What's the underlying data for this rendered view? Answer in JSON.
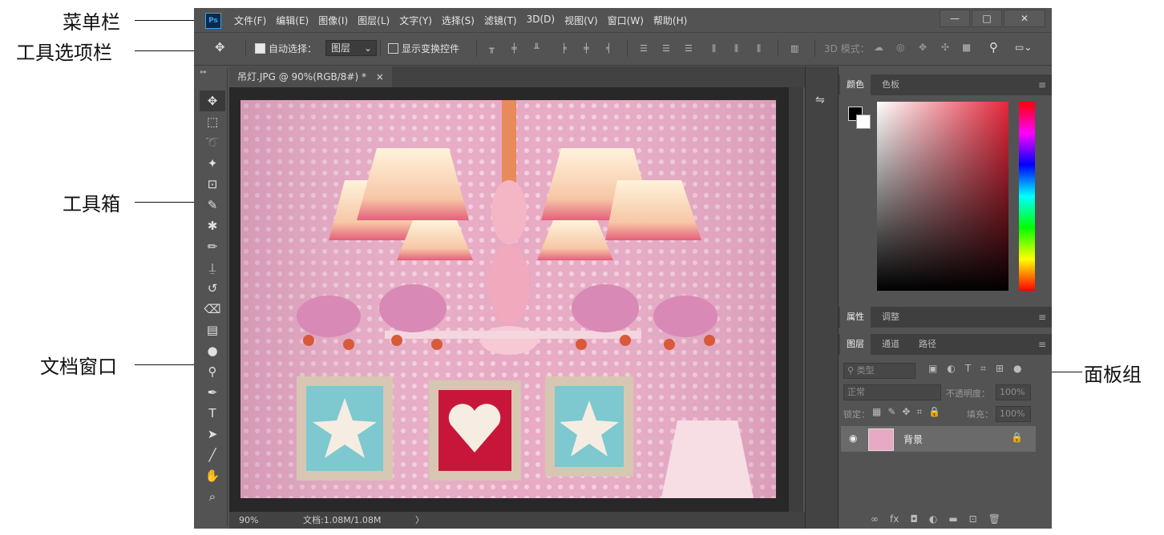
{
  "annotations": {
    "menubar": "菜单栏",
    "options_bar": "工具选项栏",
    "toolbox": "工具箱",
    "doc_window": "文档窗口",
    "panel_group": "面板组"
  },
  "app": {
    "logo": "Ps"
  },
  "menu": [
    "文件(F)",
    "编辑(E)",
    "图像(I)",
    "图层(L)",
    "文字(Y)",
    "选择(S)",
    "滤镜(T)",
    "3D(D)",
    "视图(V)",
    "窗口(W)",
    "帮助(H)"
  ],
  "window_controls": {
    "minimize": "—",
    "maximize": "□",
    "close": "✕"
  },
  "options": {
    "auto_select_label": "自动选择：",
    "auto_select_checked": true,
    "layer_select": "图层",
    "show_transform_label": "显示变换控件",
    "show_transform_checked": false,
    "mode_3d": "3D 模式："
  },
  "tools": [
    {
      "name": "move-tool",
      "glyph": "✥"
    },
    {
      "name": "marquee-tool",
      "glyph": "⬚"
    },
    {
      "name": "lasso-tool",
      "glyph": "➰"
    },
    {
      "name": "magic-wand-tool",
      "glyph": "✦"
    },
    {
      "name": "crop-tool",
      "glyph": "⊡"
    },
    {
      "name": "eyedropper-tool",
      "glyph": "✎"
    },
    {
      "name": "spot-heal-tool",
      "glyph": "✱"
    },
    {
      "name": "brush-tool",
      "glyph": "✏"
    },
    {
      "name": "stamp-tool",
      "glyph": "⍊"
    },
    {
      "name": "history-brush-tool",
      "glyph": "↺"
    },
    {
      "name": "eraser-tool",
      "glyph": "⌫"
    },
    {
      "name": "gradient-tool",
      "glyph": "▤"
    },
    {
      "name": "blur-tool",
      "glyph": "●"
    },
    {
      "name": "dodge-tool",
      "glyph": "⚲"
    },
    {
      "name": "pen-tool",
      "glyph": "✒"
    },
    {
      "name": "type-tool",
      "glyph": "T"
    },
    {
      "name": "path-select-tool",
      "glyph": "➤"
    },
    {
      "name": "line-tool",
      "glyph": "╱"
    },
    {
      "name": "hand-tool",
      "glyph": "✋"
    },
    {
      "name": "zoom-tool",
      "glyph": "⌕"
    }
  ],
  "document": {
    "tab_title": "吊灯.JPG @ 90%(RGB/8#) *",
    "close_glyph": "×",
    "zoom": "90%",
    "doc_size": "文档:1.08M/1.08M",
    "status_arrow": "〉"
  },
  "panels": {
    "color_tabs": [
      "颜色",
      "色板"
    ],
    "props_tabs": [
      "属性",
      "调整"
    ],
    "layer_tabs": [
      "图层",
      "通道",
      "路径"
    ],
    "kind_placeholder": "类型",
    "blend_mode": "正常",
    "opacity_label": "不透明度：",
    "opacity_value": "100%",
    "lock_label": "锁定：",
    "fill_label": "填充：",
    "fill_value": "100%",
    "layer_name": "背景"
  },
  "colors": {
    "accent": "#2fa3f7",
    "panel_bg": "#535353",
    "photo_bg": "#e7a9c3",
    "shade": "#e4607a"
  }
}
